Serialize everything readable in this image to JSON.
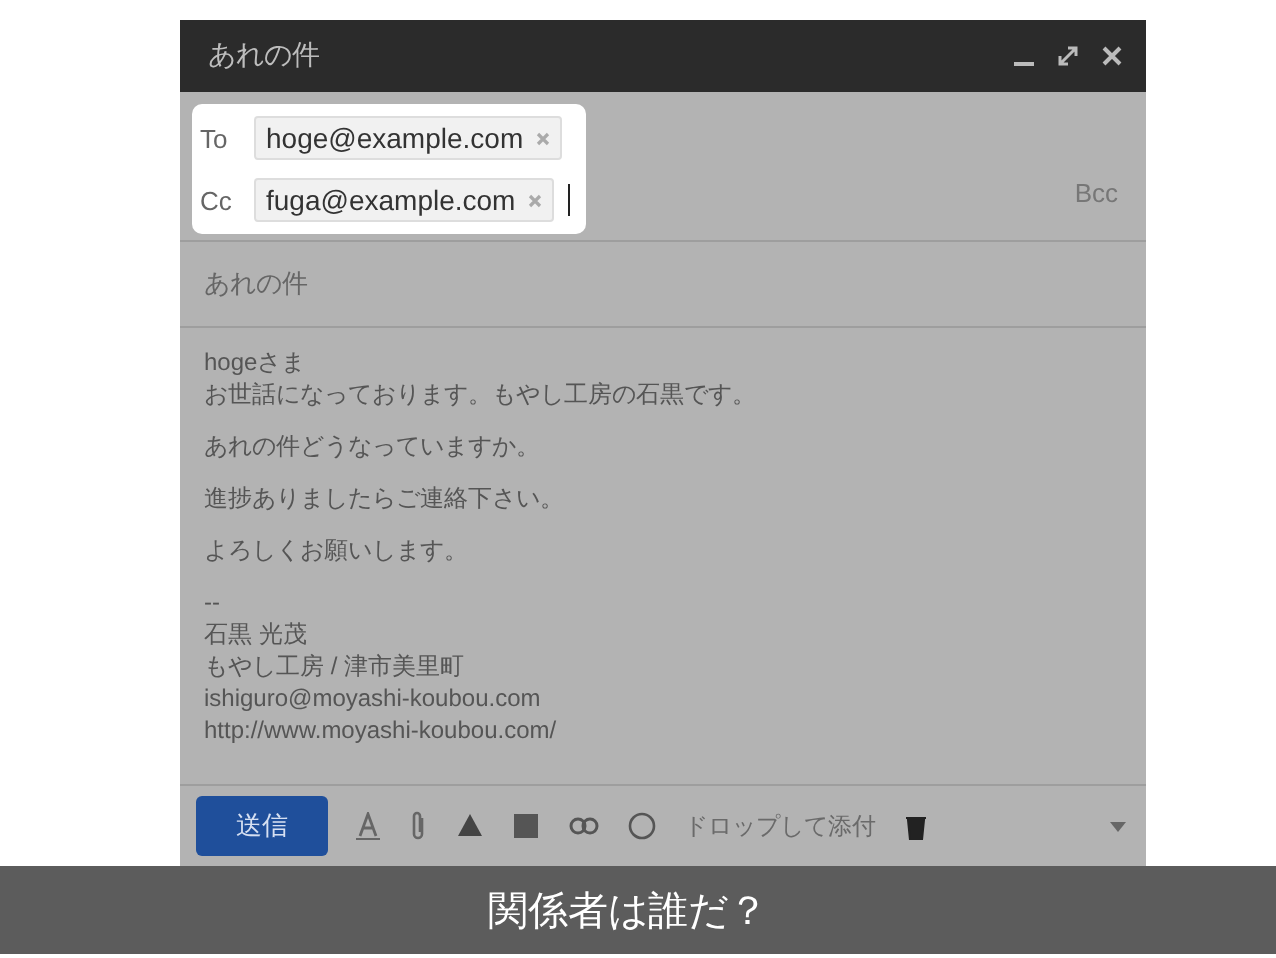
{
  "window": {
    "title": "あれの件"
  },
  "recipients": [
    {
      "label": "To",
      "chips": [
        "hoge@example.com"
      ],
      "cursor": false
    },
    {
      "label": "Cc",
      "chips": [
        "fuga@example.com"
      ],
      "cursor": true
    }
  ],
  "bcc_link": "Bcc",
  "subject": "あれの件",
  "body": [
    [
      "hogeさま",
      "お世話になっております。もやし工房の石黒です。"
    ],
    [
      "あれの件どうなっていますか。"
    ],
    [
      "進捗ありましたらご連絡下さい。"
    ],
    [
      "よろしくお願いします。"
    ],
    [
      "--",
      "石黒 光茂",
      "もやし工房 / 津市美里町",
      "ishiguro@moyashi-koubou.com",
      "http://www.moyashi-koubou.com/"
    ]
  ],
  "toolbar": {
    "send_button": "送信",
    "drop_hint": "ドロップして添付"
  },
  "caption": "関係者は誰だ？"
}
